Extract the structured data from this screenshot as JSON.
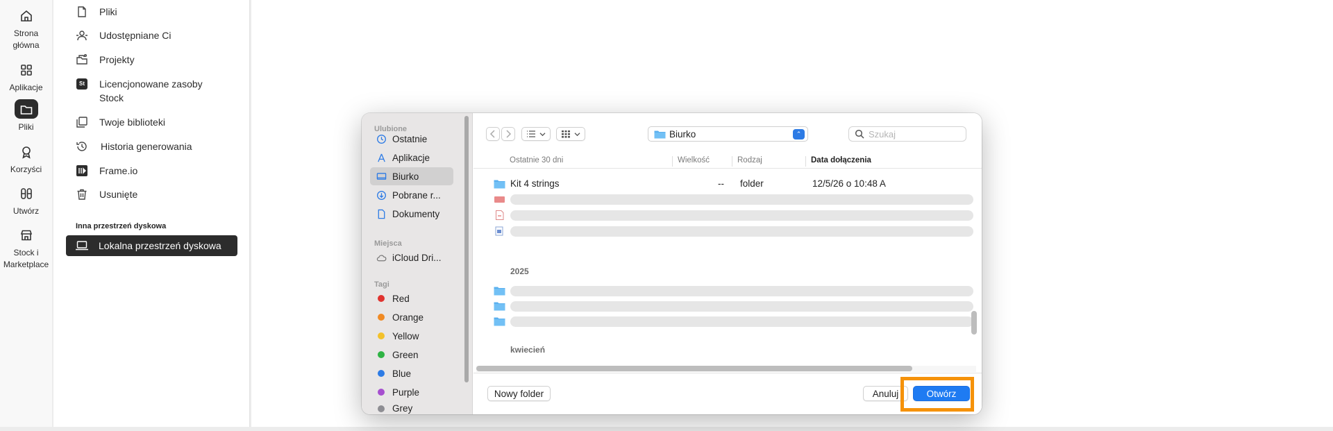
{
  "rail": {
    "items": [
      {
        "label": "Strona\ngłówna",
        "icon": "home-icon"
      },
      {
        "label": "Aplikacje",
        "icon": "apps-icon"
      },
      {
        "label": "Pliki",
        "icon": "folder-icon",
        "active": true
      },
      {
        "label": "Korzyści",
        "icon": "award-icon"
      },
      {
        "label": "Utwórz",
        "icon": "create-icon"
      },
      {
        "label": "Stock i\nMarketplace",
        "icon": "store-icon"
      }
    ]
  },
  "nav": {
    "items": [
      {
        "label": "Pliki",
        "icon": "file-icon"
      },
      {
        "label": "Udostępniane Ci",
        "icon": "shared-users-icon"
      },
      {
        "label": "Projekty",
        "icon": "projects-icon"
      },
      {
        "label": "Licencjonowane zasoby Stock",
        "icon": "stock-badge-icon",
        "badge": "St"
      },
      {
        "label": "Twoje biblioteki",
        "icon": "libraries-icon"
      },
      {
        "label": "Historia generowania",
        "icon": "history-icon"
      },
      {
        "label": "Frame.io",
        "icon": "frameio-icon"
      },
      {
        "label": "Usunięte",
        "icon": "trash-icon"
      }
    ],
    "section_title": "Inna przestrzeń dyskowa",
    "local_storage": "Lokalna przestrzeń dyskowa"
  },
  "dialog": {
    "sidebar": {
      "favorites_header": "Ulubione",
      "favorites": [
        {
          "label": "Ostatnie",
          "icon": "clock-icon"
        },
        {
          "label": "Aplikacje",
          "icon": "applications-icon"
        },
        {
          "label": "Biurko",
          "icon": "desktop-icon",
          "selected": true
        },
        {
          "label": "Pobrane r...",
          "icon": "download-icon"
        },
        {
          "label": "Dokumenty",
          "icon": "document-icon"
        }
      ],
      "places_header": "Miejsca",
      "places": [
        {
          "label": "iCloud Dri...",
          "icon": "cloud-icon"
        }
      ],
      "tags_header": "Tagi",
      "tags": [
        {
          "label": "Red",
          "color": "#e0332f"
        },
        {
          "label": "Orange",
          "color": "#f08a24"
        },
        {
          "label": "Yellow",
          "color": "#f3c12a"
        },
        {
          "label": "Green",
          "color": "#2fb344"
        },
        {
          "label": "Blue",
          "color": "#2d7be5"
        },
        {
          "label": "Purple",
          "color": "#a64fcf"
        },
        {
          "label": "Grey",
          "color": "#8e8e93"
        }
      ]
    },
    "toolbar": {
      "location": "Biurko",
      "search_placeholder": "Szukaj"
    },
    "columns": {
      "name": "Ostatnie 30 dni",
      "size": "Wielkość",
      "kind": "Rodzaj",
      "date": "Data dołączenia"
    },
    "rows": [
      {
        "name": "Kit 4 strings",
        "size": "--",
        "kind": "folder",
        "date": "12/5/26 o 10:48 A"
      }
    ],
    "groups": {
      "year": "2025",
      "month": "kwiecień"
    },
    "footer": {
      "new_folder": "Nowy folder",
      "cancel": "Anuluj",
      "open": "Otwórz"
    }
  },
  "accent": {
    "highlight": "#f5920a",
    "primary": "#1e7bf2"
  }
}
